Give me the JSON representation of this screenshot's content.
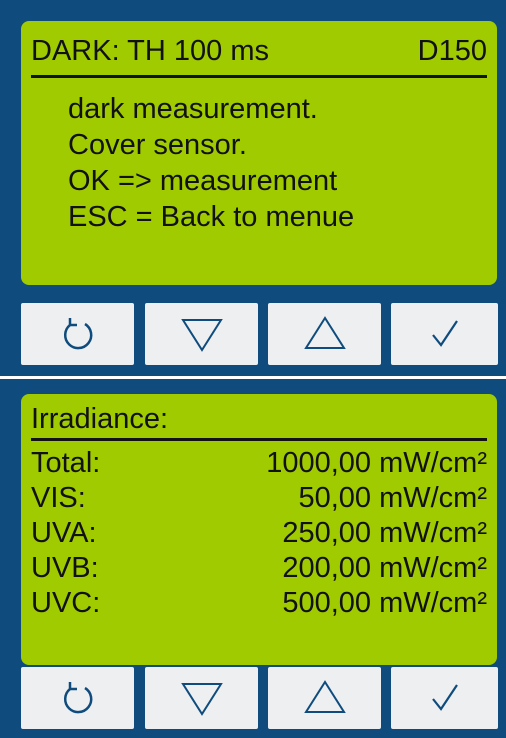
{
  "dark_screen": {
    "title": "DARK: TH 100 ms",
    "code": "D150",
    "lines": [
      "dark measurement.",
      "Cover sensor.",
      "OK => measurement",
      "ESC = Back to menue"
    ]
  },
  "irradiance_screen": {
    "title": "Irradiance:",
    "rows": [
      {
        "name": "Total:",
        "value": "1000,00 mW/cm²"
      },
      {
        "name": "VIS:",
        "value": "50,00 mW/cm²"
      },
      {
        "name": "UVA:",
        "value": "250,00 mW/cm²"
      },
      {
        "name": "UVB:",
        "value": "200,00 mW/cm²"
      },
      {
        "name": "UVC:",
        "value": "500,00 mW/cm²"
      }
    ]
  },
  "buttons": [
    "refresh-icon",
    "down-triangle-icon",
    "up-triangle-icon",
    "check-icon"
  ],
  "colors": {
    "panel_blue": "#0f4c7d",
    "lcd_green": "#9fcb00",
    "button_gray": "#edeff1",
    "text": "#111111"
  }
}
